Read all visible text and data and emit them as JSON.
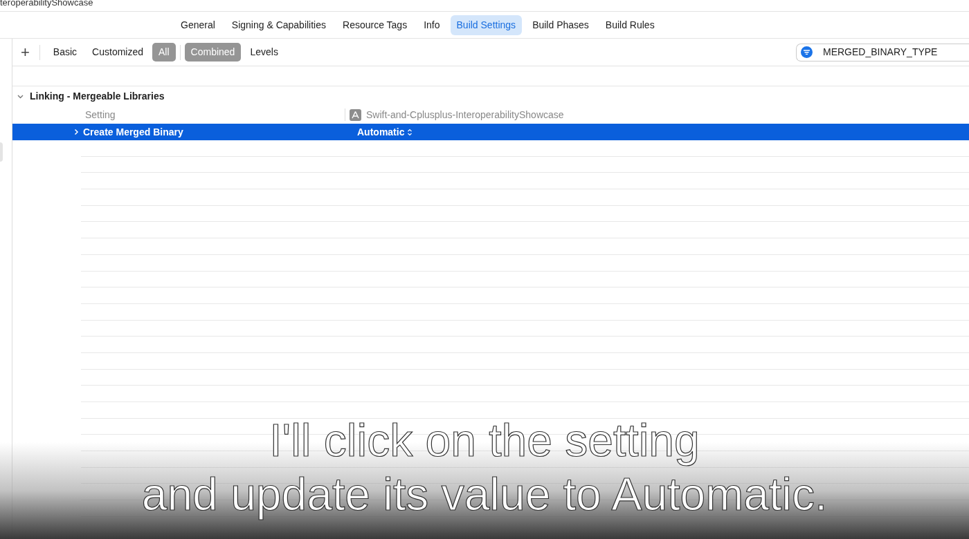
{
  "window": {
    "title": "teroperabilityShowcase"
  },
  "tabs": [
    {
      "label": "General",
      "selected": false
    },
    {
      "label": "Signing & Capabilities",
      "selected": false
    },
    {
      "label": "Resource Tags",
      "selected": false
    },
    {
      "label": "Info",
      "selected": false
    },
    {
      "label": "Build Settings",
      "selected": true
    },
    {
      "label": "Build Phases",
      "selected": false
    },
    {
      "label": "Build Rules",
      "selected": false
    }
  ],
  "filter_bar": {
    "add_button": "+",
    "scopes": [
      {
        "label": "Basic",
        "selected": false
      },
      {
        "label": "Customized",
        "selected": false
      },
      {
        "label": "All",
        "selected": true
      }
    ],
    "views": [
      {
        "label": "Combined",
        "selected": true
      },
      {
        "label": "Levels",
        "selected": false
      }
    ],
    "search": {
      "value": "MERGED_BINARY_TYPE"
    }
  },
  "section": {
    "title": "Linking - Mergeable Libraries",
    "expanded": true,
    "column_headers": {
      "setting": "Setting",
      "target": "Swift-and-Cplusplus-InteroperabilityShowcase"
    },
    "rows": [
      {
        "name": "Create Merged Binary",
        "value": "Automatic",
        "selected": true,
        "expanded": false
      }
    ]
  },
  "caption": [
    "I'll click on the setting",
    "and update its value to Automatic."
  ]
}
